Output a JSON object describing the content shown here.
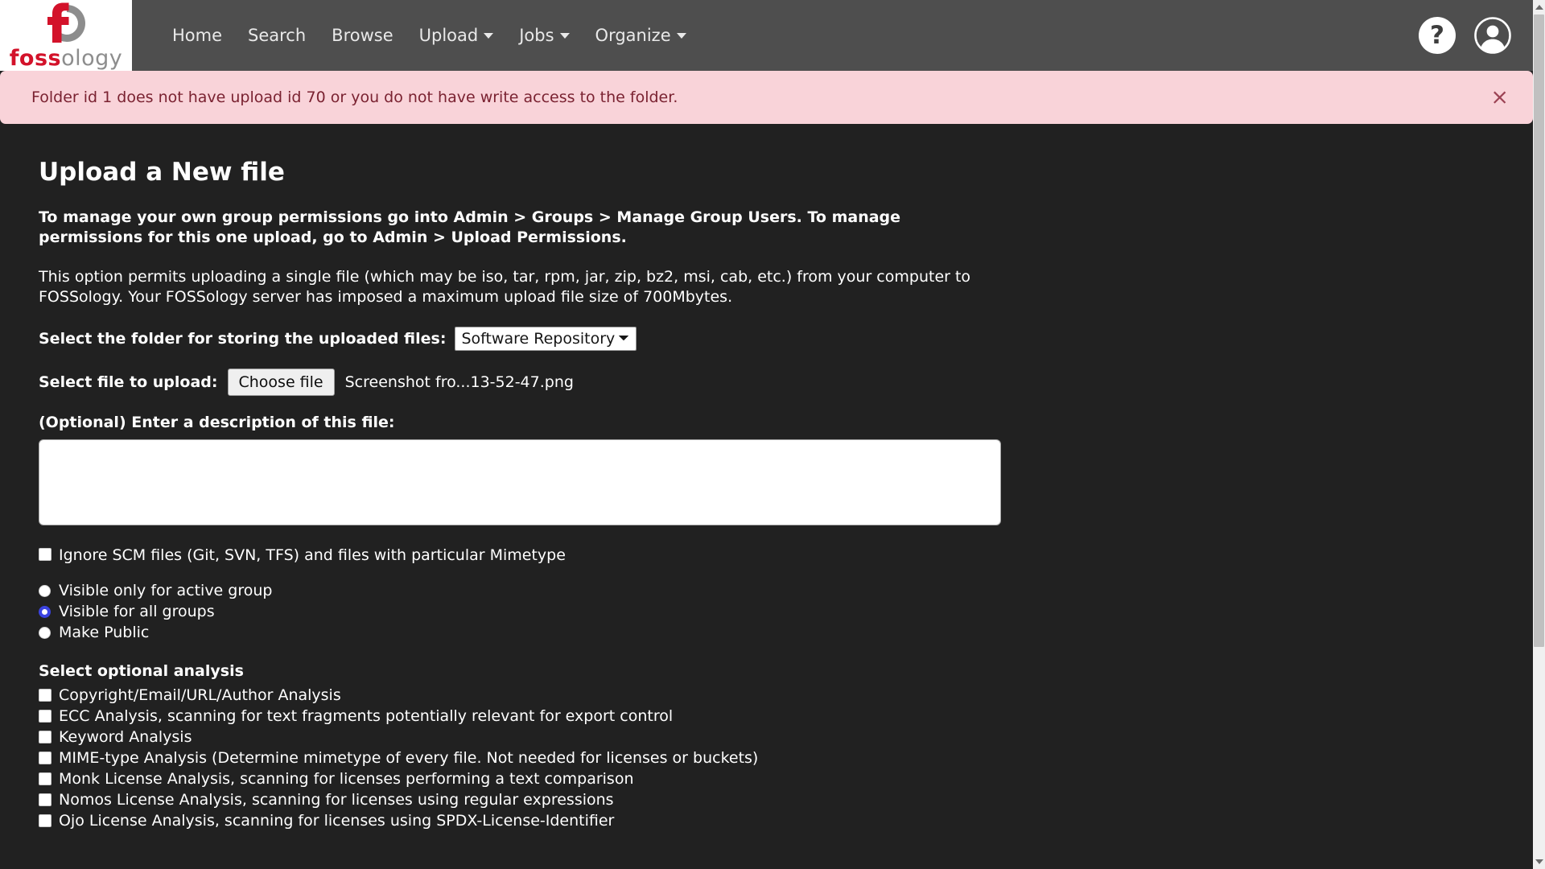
{
  "navbar": {
    "logo": {
      "icon": "fossology-logo-icon",
      "word_red": "foss",
      "word_gray": "ology"
    },
    "links": [
      {
        "label": "Home",
        "has_caret": false
      },
      {
        "label": "Search",
        "has_caret": false
      },
      {
        "label": "Browse",
        "has_caret": false
      },
      {
        "label": "Upload",
        "has_caret": true
      },
      {
        "label": "Jobs",
        "has_caret": true
      },
      {
        "label": "Organize",
        "has_caret": true
      }
    ],
    "help_icon_glyph": "?",
    "help_icon_name": "help-icon",
    "avatar_icon_name": "user-avatar-icon",
    "bar_color": "#4e4e4e"
  },
  "alert": {
    "message": "Folder id 1 does not have upload id 70 or you do not have write access to the folder.",
    "close_glyph": "×",
    "background": "#f9d3d9",
    "text_color": "#7a2231"
  },
  "main": {
    "title": "Upload a New file",
    "intro_bold": "To manage your own group permissions go into Admin > Groups > Manage Group Users. To manage permissions for this one upload, go to Admin > Upload Permissions.",
    "intro_text": "This option permits uploading a single file (which may be iso, tar, rpm, jar, zip, bz2, msi, cab, etc.) from your computer to FOSSology. Your FOSSology server has imposed a maximum upload file size of 700Mbytes.",
    "folder_label": "Select the folder for storing the uploaded files:",
    "folder_selected": "Software Repository",
    "folder_options": [
      "Software Repository"
    ],
    "file_label": "Select file to upload:",
    "choose_file_button": "Choose file",
    "file_name": "Screenshot fro...13-52-47.png",
    "description_label": "(Optional) Enter a description of this file:",
    "description_value": "",
    "description_placeholder": "",
    "ignore_scm": {
      "label": "Ignore SCM files (Git, SVN, TFS) and files with particular Mimetype",
      "checked": false
    },
    "visibility_options": [
      {
        "label": "Visible only for active group",
        "selected": false
      },
      {
        "label": "Visible for all groups",
        "selected": true
      },
      {
        "label": "Make Public",
        "selected": false
      }
    ],
    "analysis_title": "Select optional analysis",
    "analysis_options": [
      {
        "label": "Copyright/Email/URL/Author Analysis",
        "checked": false
      },
      {
        "label": "ECC Analysis, scanning for text fragments potentially relevant for export control",
        "checked": false
      },
      {
        "label": "Keyword Analysis",
        "checked": false
      },
      {
        "label": "MIME-type Analysis (Determine mimetype of every file. Not needed for licenses or buckets)",
        "checked": false
      },
      {
        "label": "Monk License Analysis, scanning for licenses performing a text comparison",
        "checked": false
      },
      {
        "label": "Nomos License Analysis, scanning for licenses using regular expressions",
        "checked": false
      },
      {
        "label": "Ojo License Analysis, scanning for licenses using SPDX-License-Identifier",
        "checked": false
      }
    ]
  },
  "scrollbar": {
    "up_arrow_name": "scroll-up-arrow",
    "down_arrow_name": "scroll-down-arrow"
  },
  "colors": {
    "page_background": "#212121",
    "accent_red": "#d3122a",
    "radio_selected": "#3b43e0"
  }
}
